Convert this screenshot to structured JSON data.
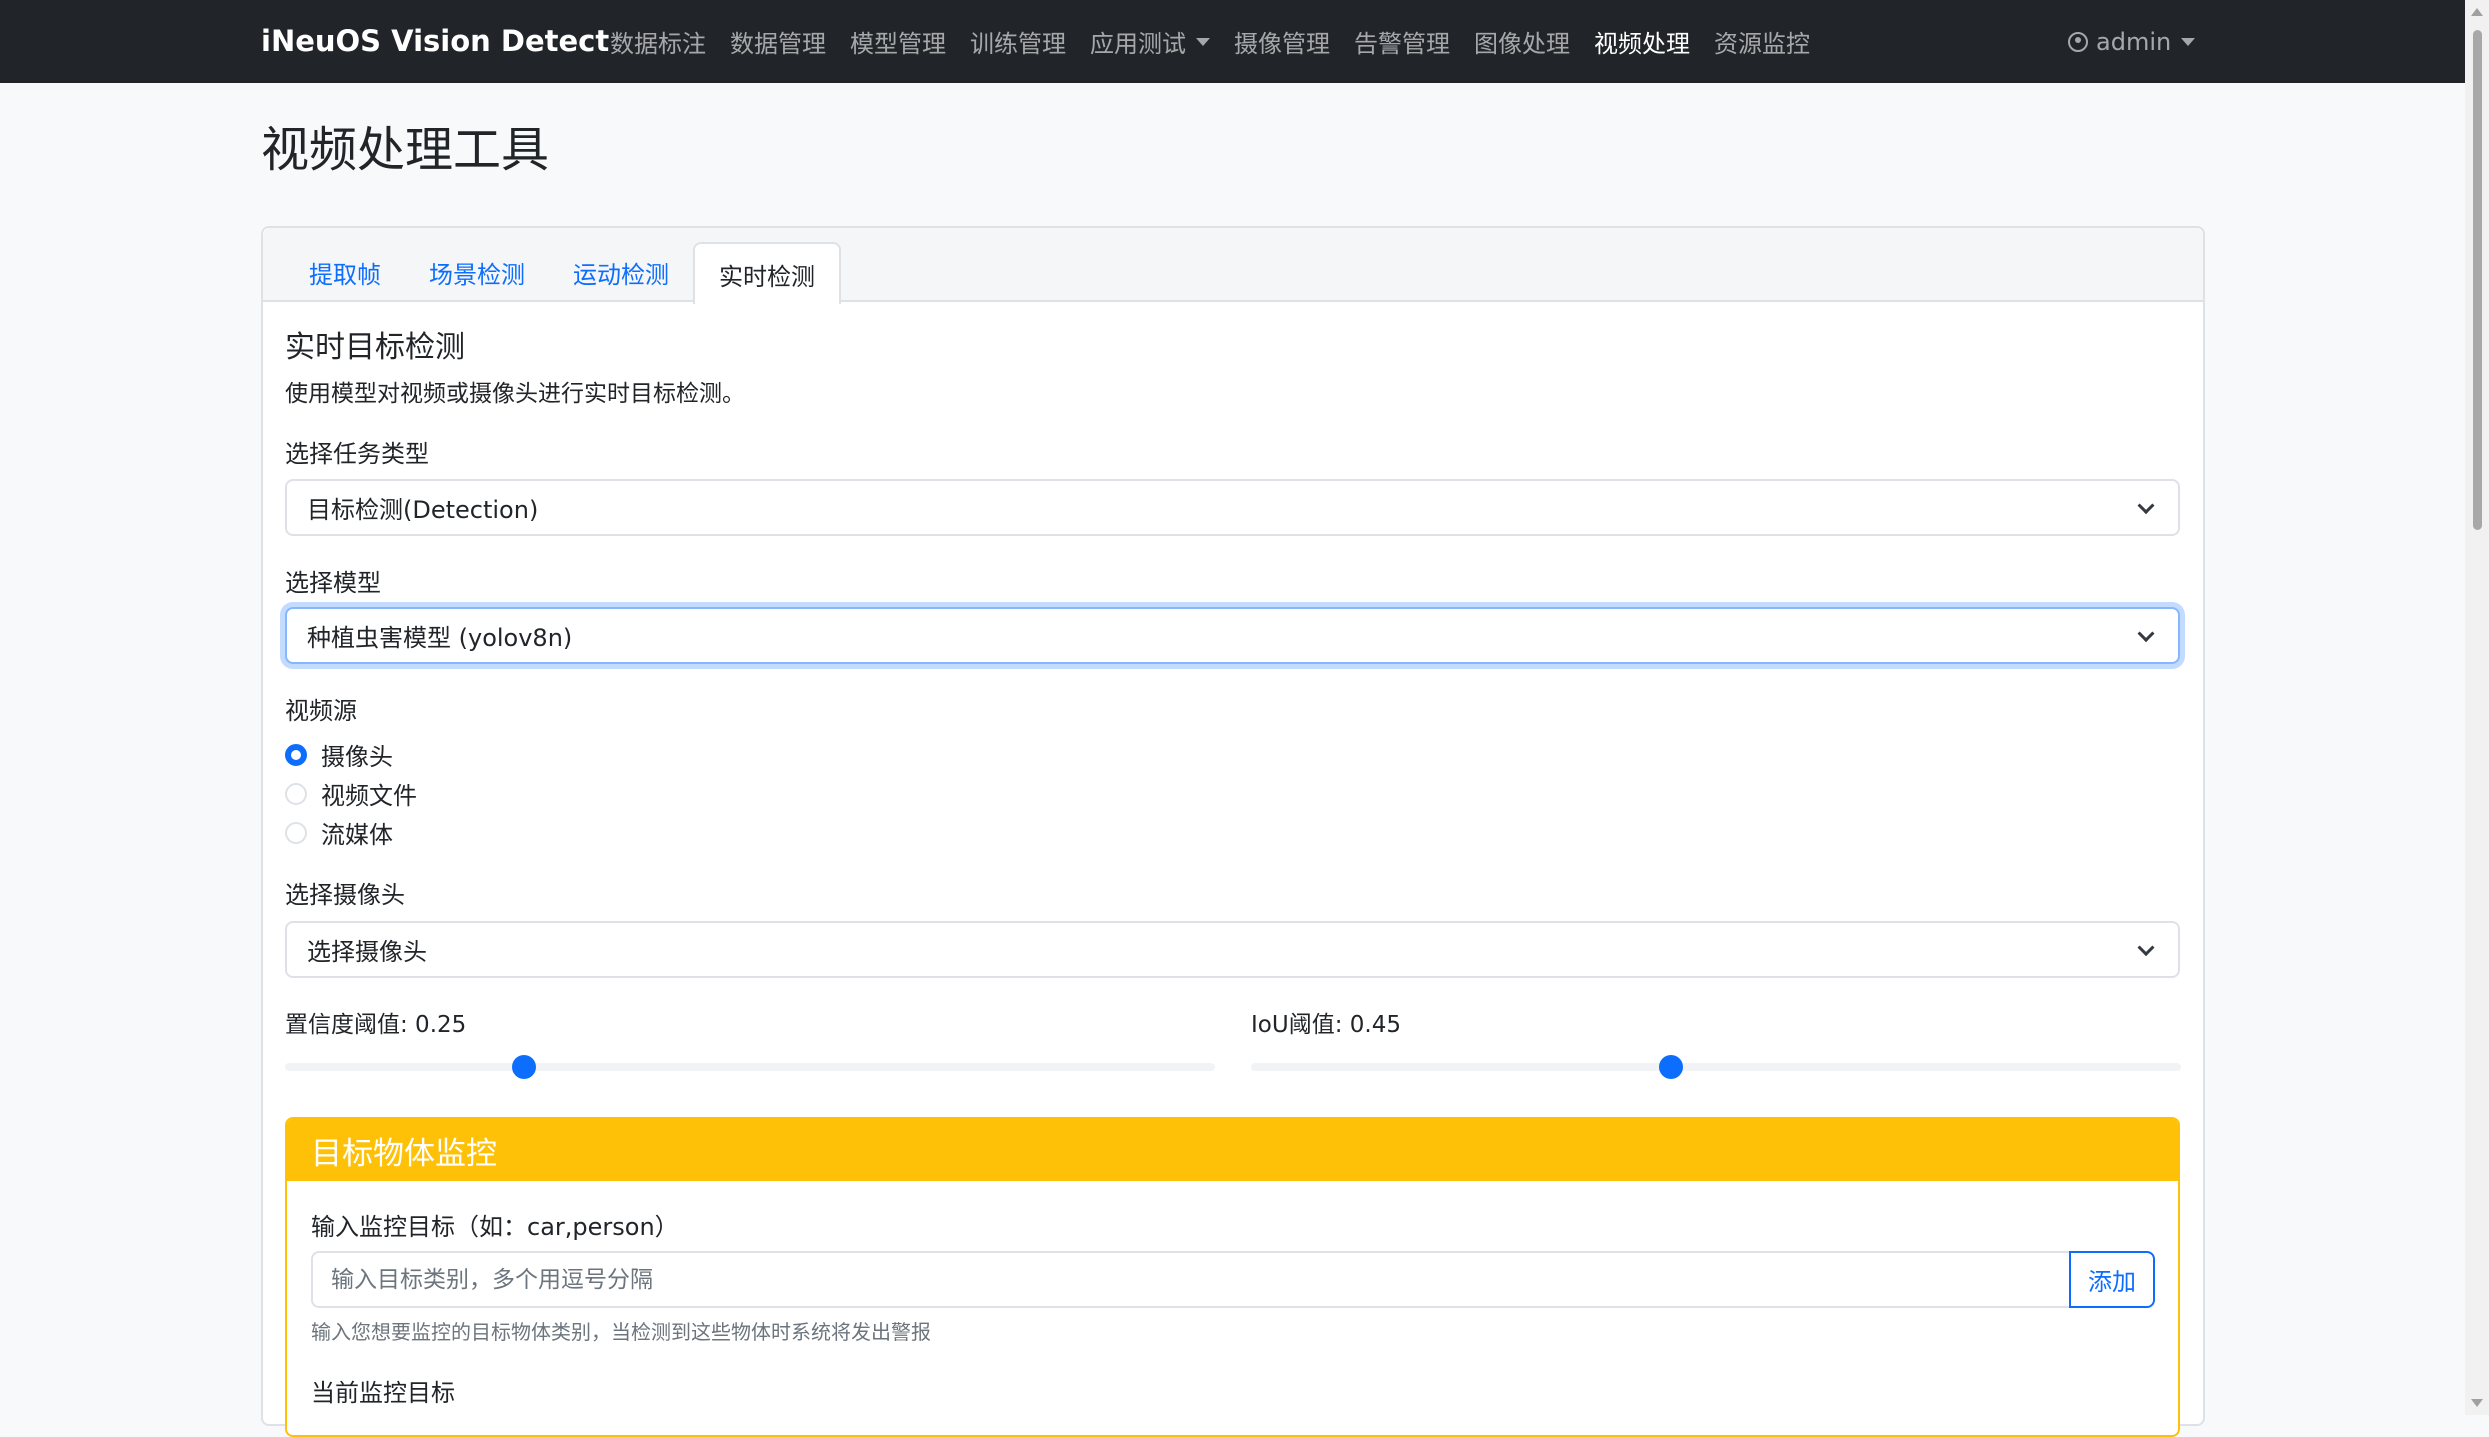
{
  "navbar": {
    "brand": "iNeuOS Vision Detect",
    "items": [
      {
        "label": "数据标注"
      },
      {
        "label": "数据管理"
      },
      {
        "label": "模型管理"
      },
      {
        "label": "训练管理"
      },
      {
        "label": "应用测试"
      },
      {
        "label": "摄像管理"
      },
      {
        "label": "告警管理"
      },
      {
        "label": "图像处理"
      },
      {
        "label": "视频处理"
      },
      {
        "label": "资源监控"
      }
    ],
    "user": "admin"
  },
  "page": {
    "title": "视频处理工具"
  },
  "tabs": [
    {
      "label": "提取帧"
    },
    {
      "label": "场景检测"
    },
    {
      "label": "运动检测"
    },
    {
      "label": "实时检测"
    }
  ],
  "realtime": {
    "title": "实时目标检测",
    "description": "使用模型对视频或摄像头进行实时目标检测。",
    "task_label": "选择任务类型",
    "task_value": "目标检测(Detection)",
    "model_label": "选择模型",
    "model_value": "种植虫害模型 (yolov8n)",
    "source_label": "视频源",
    "sources": [
      {
        "label": "摄像头",
        "checked": true
      },
      {
        "label": "视频文件",
        "checked": false
      },
      {
        "label": "流媒体",
        "checked": false
      }
    ],
    "camera_label": "选择摄像头",
    "camera_value": "选择摄像头",
    "confidence_label": "置信度阈值: 0.25",
    "confidence": 0.25,
    "iou_label": "IoU阈值: 0.45",
    "iou": 0.45
  },
  "monitor": {
    "header": "目标物体监控",
    "input_label": "输入监控目标（如：car,person）",
    "input_placeholder": "输入目标类别，多个用逗号分隔",
    "add_button": "添加",
    "help": "输入您想要监控的目标物体类别，当检测到这些物体时系统将发出警报",
    "current_label": "当前监控目标"
  },
  "colors": {
    "navbar": "#212529",
    "primary": "#0d6efd",
    "warning": "#ffc107"
  }
}
